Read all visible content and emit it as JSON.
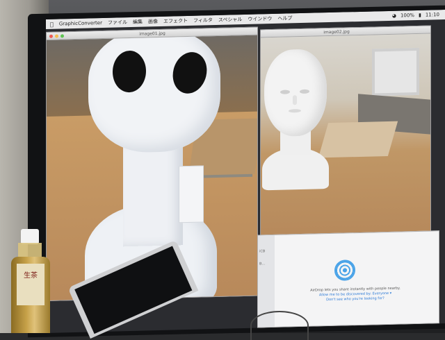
{
  "menubar": {
    "app_name": "GraphicConverter",
    "items": [
      "ファイル",
      "編集",
      "画像",
      "エフェクト",
      "フィルタ",
      "スペシャル",
      "ウインドウ",
      "ヘルプ"
    ],
    "time": "11:10",
    "battery": "100%"
  },
  "windows": {
    "left_title": "image01.jpg",
    "right_title": "image02.jpg"
  },
  "airdrop": {
    "sidebar_labels": [
      "iCB",
      "B..."
    ],
    "description": "AirDrop lets you share instantly with people nearby.",
    "discover_link": "Allow me to be discovered by: Everyone ▾",
    "help_link": "Don't see who you're looking for?"
  },
  "bottle": {
    "brand": "生茶"
  },
  "colors": {
    "menubar": "#e9e9ea",
    "airdrop_blue": "#4aa3e8",
    "foam": "#f1f3f6",
    "table_wood": "#c99c66"
  }
}
